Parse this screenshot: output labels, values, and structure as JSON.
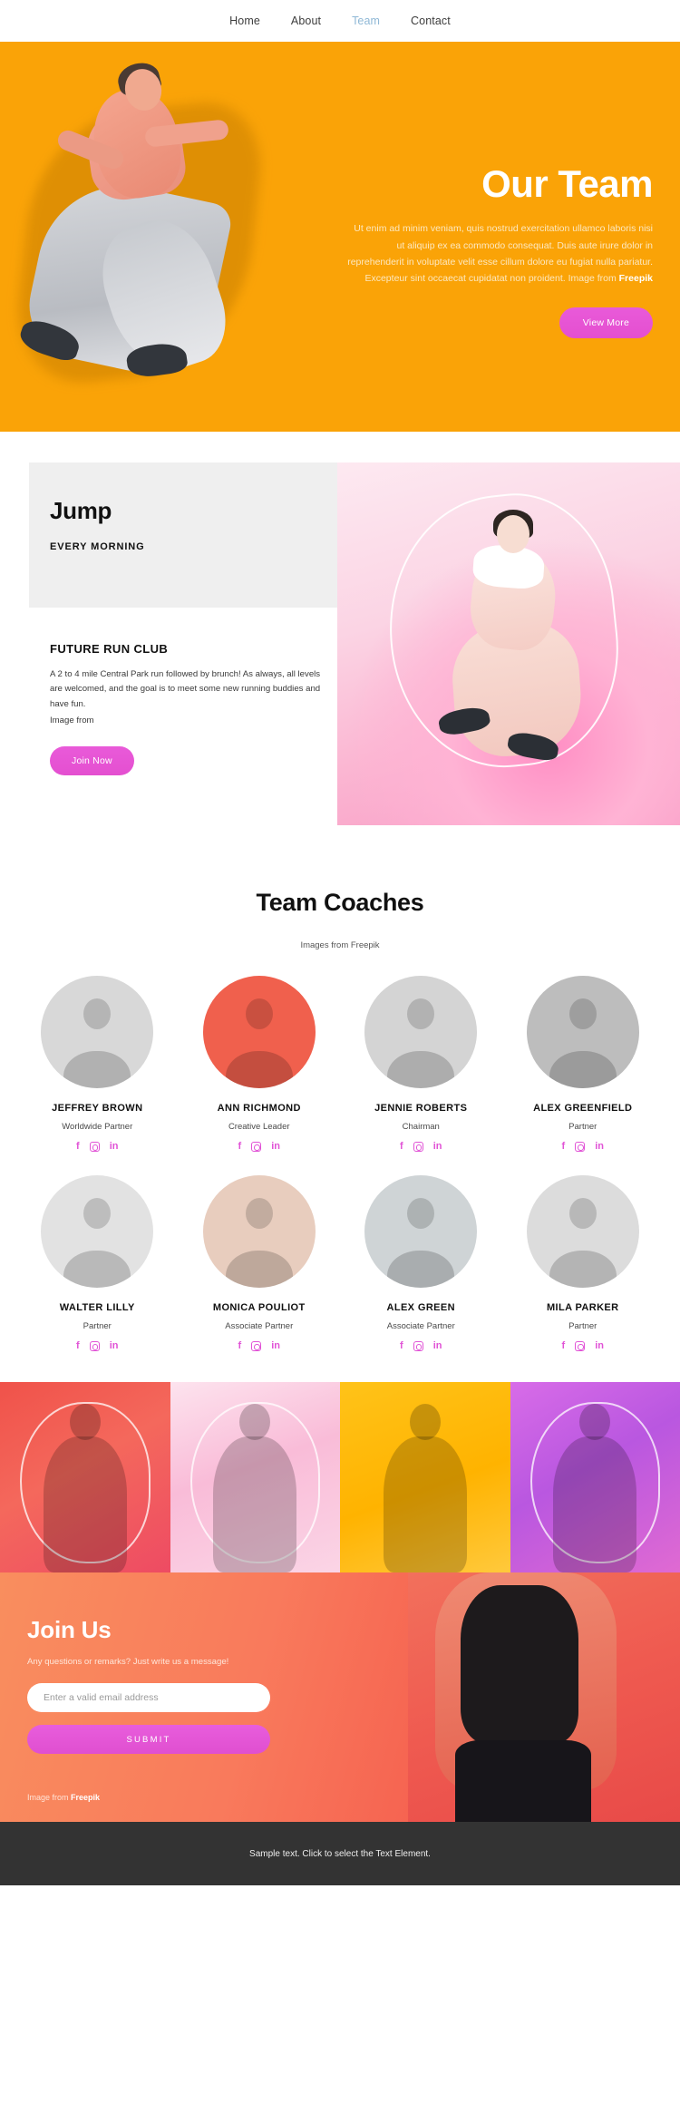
{
  "nav": {
    "items": [
      {
        "label": "Home",
        "active": false
      },
      {
        "label": "About",
        "active": false
      },
      {
        "label": "Team",
        "active": true
      },
      {
        "label": "Contact",
        "active": false
      }
    ]
  },
  "hero": {
    "title": "Our Team",
    "paragraph": "Ut enim ad minim veniam, quis nostrud exercitation ullamco laboris nisi ut aliquip ex ea commodo consequat. Duis aute irure dolor in reprehenderit in voluptate velit esse cillum dolore eu fugiat nulla pariatur. Excepteur sint occaecat cupidatat non proident. Image from ",
    "paragraph_bold": "Freepik",
    "button_label": "View More",
    "background_color": "#faa307"
  },
  "jump": {
    "title": "Jump",
    "subtitle": "EVERY MORNING",
    "club_title": "FUTURE RUN CLUB",
    "club_text": "A 2 to 4 mile Central Park run followed by brunch! As always, all levels are welcomed, and the goal is to meet some new running buddies and have fun.",
    "club_credit": "Image from",
    "button_label": "Join Now"
  },
  "coaches": {
    "heading": "Team Coaches",
    "subheading": "Images from Freepik",
    "social_icons": [
      "facebook-icon",
      "instagram-icon",
      "linkedin-icon"
    ],
    "accent_color": "#e153d6",
    "members": [
      {
        "name": "JEFFREY BROWN",
        "role": "Worldwide Partner",
        "photo_bg": "#d8d8d8"
      },
      {
        "name": "ANN RICHMOND",
        "role": "Creative Leader",
        "photo_bg": "#f0604d"
      },
      {
        "name": "JENNIE ROBERTS",
        "role": "Chairman",
        "photo_bg": "#d4d4d4"
      },
      {
        "name": "ALEX GREENFIELD",
        "role": "Partner",
        "photo_bg": "#bdbdbd"
      },
      {
        "name": "WALTER LILLY",
        "role": "Partner",
        "photo_bg": "#e2e2e2"
      },
      {
        "name": "MONICA POULIOT",
        "role": "Associate Partner",
        "photo_bg": "#e8cdbe"
      },
      {
        "name": "ALEX GREEN",
        "role": "Associate Partner",
        "photo_bg": "#cfd4d6"
      },
      {
        "name": "MILA PARKER",
        "role": "Partner",
        "photo_bg": "#dcdcdc"
      }
    ]
  },
  "strip": {
    "cells": [
      {
        "name": "photo-man-headphones",
        "color": "#f0524a"
      },
      {
        "name": "photo-woman-jumprope",
        "color": "#f9bcd8"
      },
      {
        "name": "photo-man-battlerope",
        "color": "#ffb300"
      },
      {
        "name": "photo-woman-dumbbells",
        "color": "#c65ce0"
      }
    ]
  },
  "joinus": {
    "heading": "Join Us",
    "subtext": "Any questions or remarks? Just write us a message!",
    "email_placeholder": "Enter a valid email address",
    "email_value": "",
    "submit_label": "SUBMIT",
    "credit": "Image from ",
    "credit_bold": "Freepik"
  },
  "footer": {
    "text": "Sample text. Click to select the Text Element."
  }
}
